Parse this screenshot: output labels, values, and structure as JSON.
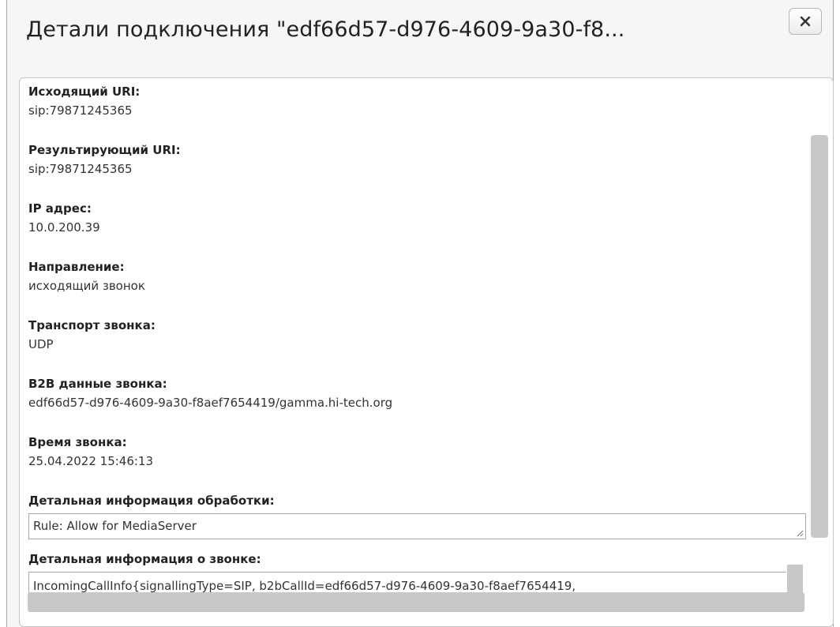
{
  "dialog": {
    "title": "Детали подключения \"edf66d57-d976-4609-9a30-f8..."
  },
  "fields": [
    {
      "label": "Исходящий URI:",
      "value": "sip:79871245365"
    },
    {
      "label": "Результирующий URI:",
      "value": "sip:79871245365"
    },
    {
      "label": "IP адрес:",
      "value": "10.0.200.39"
    },
    {
      "label": "Направление:",
      "value": "исходящий звонок"
    },
    {
      "label": "Транспорт звонка:",
      "value": "UDP"
    },
    {
      "label": "B2B данные звонка:",
      "value": "edf66d57-d976-4609-9a30-f8aef7654419/gamma.hi-tech.org"
    },
    {
      "label": "Время звонка:",
      "value": "25.04.2022 15:46:13"
    }
  ],
  "processing": {
    "label": "Детальная информация обработки:",
    "value": "Rule: Allow for MediaServer"
  },
  "call_info": {
    "label": "Детальная информация о звонке:",
    "value": "IncomingCallInfo{signallingType=SIP, b2bCallId=edf66d57-d976-4609-9a30-f8aef7654419,"
  },
  "icons": {
    "close": "close-icon",
    "resize": "resize-grip-icon"
  },
  "colors": {
    "dialog_bg": "#f6f6f6",
    "panel_bg": "#ffffff",
    "scrollbar": "#c8c8c8"
  }
}
